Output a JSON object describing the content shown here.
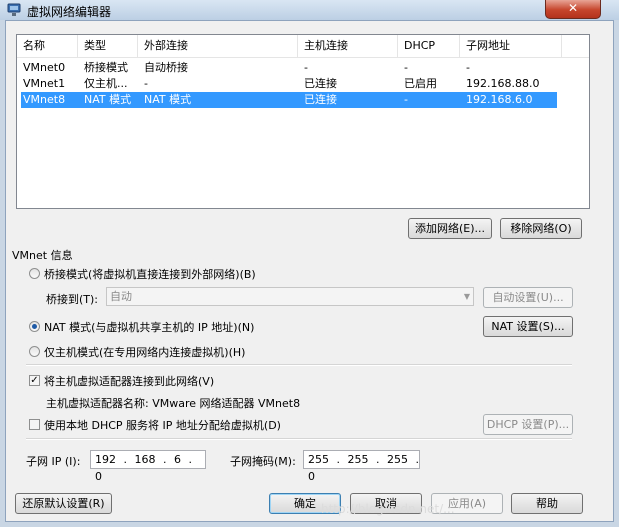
{
  "window": {
    "title": "虚拟网络编辑器",
    "close_glyph": "✕"
  },
  "network_table": {
    "columns": [
      "名称",
      "类型",
      "外部连接",
      "主机连接",
      "DHCP",
      "子网地址"
    ],
    "rows": [
      [
        "VMnet0",
        "桥接模式",
        "自动桥接",
        "-",
        "-",
        "-"
      ],
      [
        "VMnet1",
        "仅主机...",
        "-",
        "已连接",
        "已启用",
        "192.168.88.0"
      ],
      [
        "VMnet8",
        "NAT 模式",
        "NAT 模式",
        "已连接",
        "-",
        "192.168.6.0"
      ]
    ],
    "selected_index": 2
  },
  "buttons": {
    "add_network": "添加网络(E)...",
    "remove_network": "移除网络(O)",
    "auto_settings": "自动设置(U)...",
    "nat_settings": "NAT 设置(S)...",
    "dhcp_settings": "DHCP 设置(P)...",
    "restore_defaults": "还原默认设置(R)",
    "ok": "确定",
    "cancel": "取消",
    "apply": "应用(A)",
    "help": "帮助"
  },
  "vmnet_info": {
    "section_label": "VMnet 信息",
    "bridged_option": "桥接模式(将虚拟机直接连接到外部网络)(B)",
    "bridge_to_label": "桥接到(T):",
    "bridge_to_value": "自动",
    "nat_option": "NAT 模式(与虚拟机共享主机的 IP 地址)(N)",
    "host_only_option": "仅主机模式(在专用网络内连接虚拟机)(H)",
    "selected_mode": "nat",
    "connect_adapter_label": "将主机虚拟适配器连接到此网络(V)",
    "connect_adapter_checked": true,
    "adapter_name_label": "主机虚拟适配器名称: VMware 网络适配器 VMnet8",
    "use_dhcp_label": "使用本地 DHCP 服务将 IP 地址分配给虚拟机(D)",
    "use_dhcp_checked": false,
    "subnet_ip_label": "子网 IP (I):",
    "subnet_ip_value": "192 . 168 . 6 . 0",
    "subnet_mask_label": "子网掩码(M):",
    "subnet_mask_value": "255 . 255 . 255 . 0"
  },
  "watermark_text": "http://blog.csdn.net/..."
}
